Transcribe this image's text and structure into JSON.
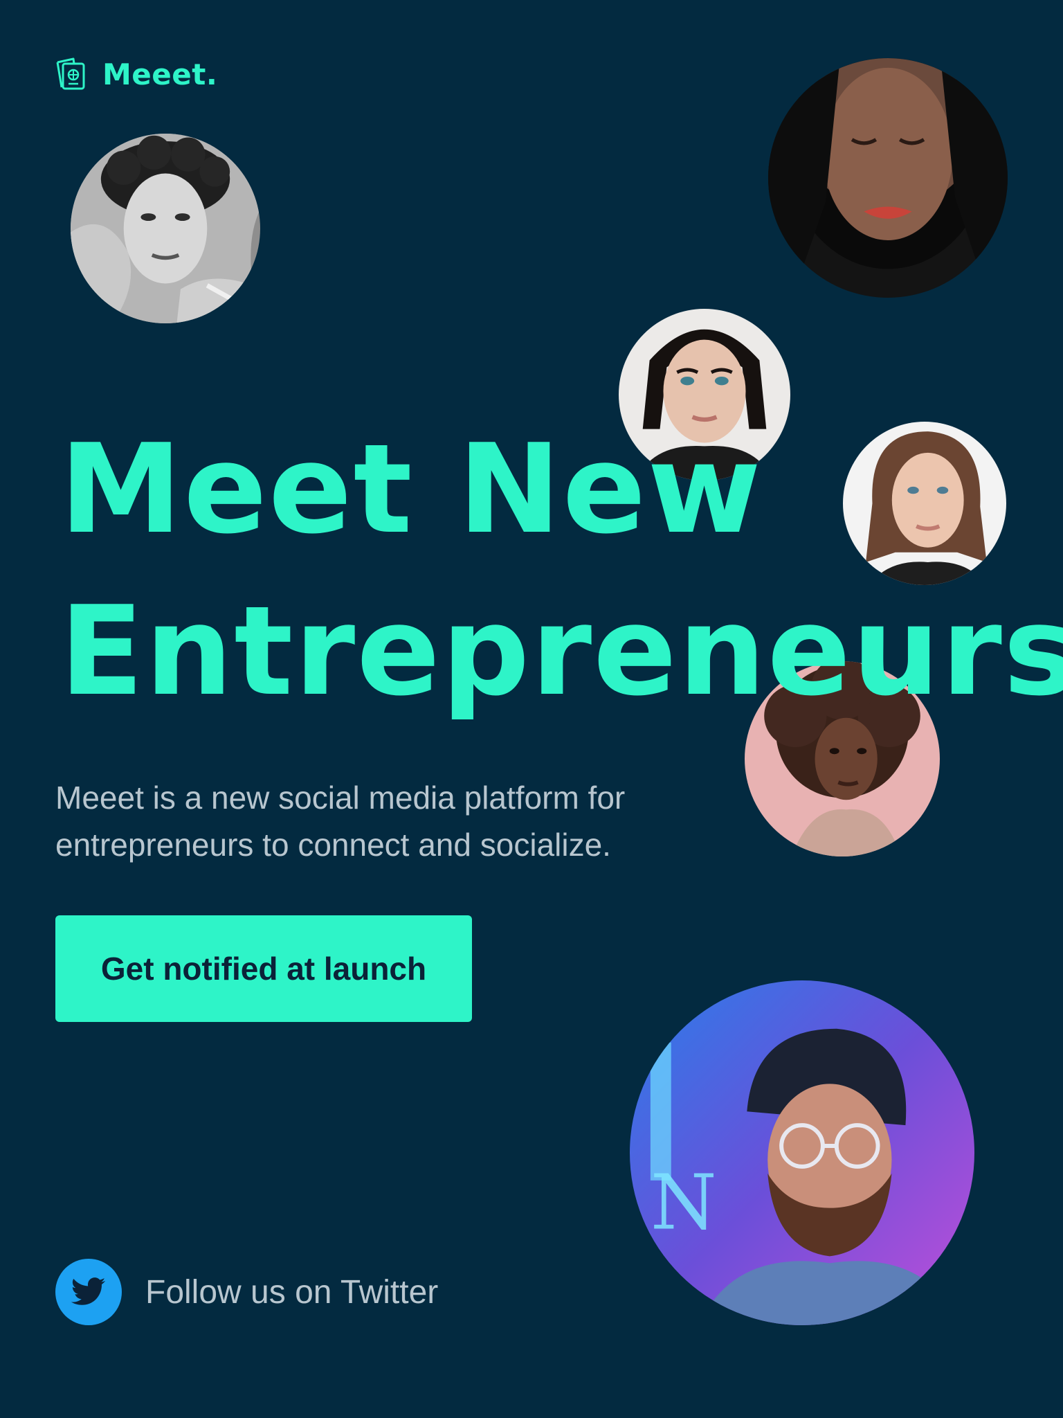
{
  "brand": {
    "name": "Meeet.",
    "icon": "passport-icon"
  },
  "colors": {
    "background": "#032a40",
    "accent": "#2ef4c8",
    "body_text": "#b8c6cf",
    "button_text": "#0b2238",
    "twitter_blue": "#1da1f2"
  },
  "hero": {
    "title_line1": "Meet New",
    "title_line2": "Entrepreneurs",
    "description": "Meeet is a new social media platform for entrepreneurs to connect and socialize."
  },
  "cta": {
    "label": "Get notified at launch"
  },
  "social": {
    "twitter_label": "Follow us on Twitter",
    "icon": "twitter-bird-icon"
  },
  "avatars": [
    "avatar-man-curly-hair-bw",
    "avatar-woman-dark-hair-eyes-closed",
    "avatar-woman-black-hair-blue-eyes",
    "avatar-woman-brown-bob",
    "avatar-woman-curly-afro",
    "avatar-man-beanie-neon"
  ]
}
